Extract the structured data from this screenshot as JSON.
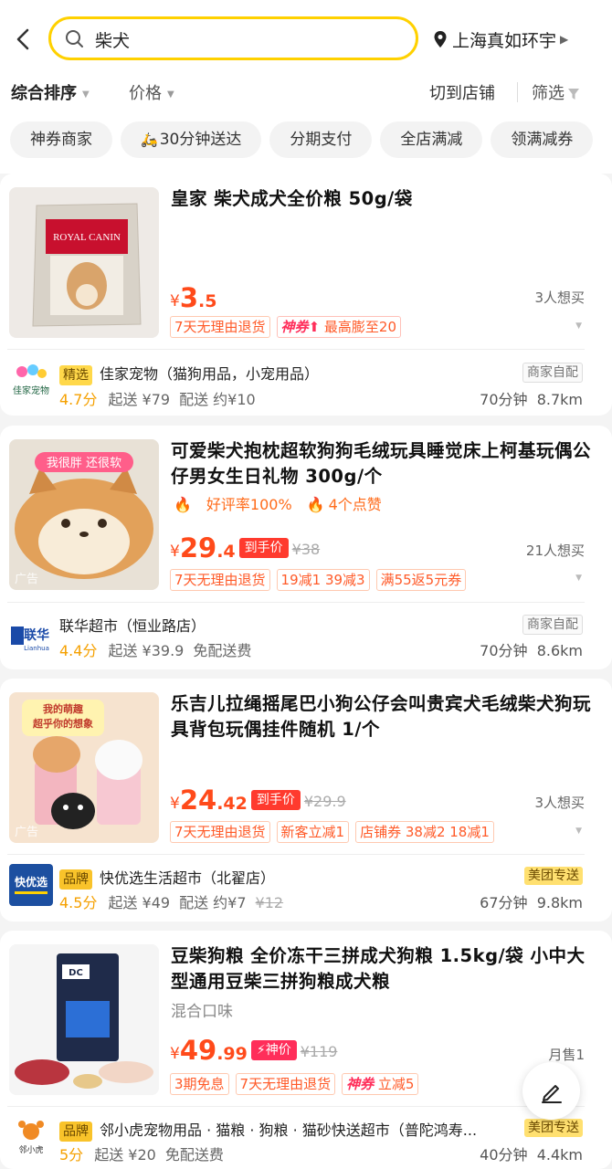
{
  "header": {
    "search_query": "柴犬",
    "location": "上海真如环宇"
  },
  "sort_bar": {
    "comprehensive": "综合排序",
    "price": "价格",
    "switch_to_store": "切到店铺",
    "filter": "筛选"
  },
  "filter_chips": [
    "神券商家",
    "30分钟送达",
    "分期支付",
    "全店满减",
    "领满减券"
  ],
  "products": [
    {
      "title": "皇家 柴犬成犬全价粮 50g/袋",
      "price_int": "3",
      "price_dec": ".5",
      "want": "3人想买",
      "tags": [
        "7天无理由退货"
      ],
      "promo_label": "神券",
      "promo_text": "最高膨至20",
      "shop": {
        "badge": "精选",
        "name": "佳家宠物（猫狗用品，小宠用品）",
        "rating": "4.7分",
        "min_order": "起送 ¥79",
        "delivery": "配送 约¥10",
        "time": "70分钟",
        "distance": "8.7km",
        "ship_tag": "商家自配",
        "logo_text": "佳家宠物"
      },
      "image_text": "ROYAL CANIN"
    },
    {
      "title": "可爱柴犬抱枕超软狗狗毛绒玩具睡觉床上柯基玩偶公仔男女生日礼物 300g/个",
      "hot": [
        "好评率100%",
        "4个点赞"
      ],
      "price_int": "29",
      "price_dec": ".4",
      "final_label": "到手价",
      "old_price": "¥38",
      "want": "21人想买",
      "tags": [
        "7天无理由退货",
        "19减1 39减3",
        "满55返5元券"
      ],
      "ad_label": "广告",
      "image_banner": "我很胖 还很软",
      "shop": {
        "name": "联华超市（恒业路店）",
        "rating": "4.4分",
        "min_order": "起送 ¥39.9",
        "delivery": "免配送费",
        "time": "70分钟",
        "distance": "8.6km",
        "ship_tag": "商家自配",
        "logo_text": "联华",
        "logo_sub": "Lianhua"
      }
    },
    {
      "title": "乐吉儿拉绳摇尾巴小狗公仔会叫贵宾犬毛绒柴犬狗玩具背包玩偶挂件随机 1/个",
      "price_int": "24",
      "price_dec": ".42",
      "final_label": "到手价",
      "old_price": "¥29.9",
      "want": "3人想买",
      "tags": [
        "7天无理由退货",
        "新客立减1",
        "店铺券 38减2 18减1"
      ],
      "ad_label": "广告",
      "image_banner": "我的萌趣 超乎你的想象",
      "shop": {
        "badge": "品牌",
        "name": "快优选生活超市（北翟店）",
        "rating": "4.5分",
        "min_order": "起送 ¥49",
        "delivery": "配送 约¥7",
        "delivery_old": "¥12",
        "time": "67分钟",
        "distance": "9.8km",
        "ship_tag": "美团专送",
        "logo_text": "快优选"
      }
    },
    {
      "title": "豆柴狗粮 全价冻干三拼成犬狗粮 1.5kg/袋 小中大型通用豆柴三拼狗粮成犬粮",
      "flavor": "混合口味",
      "price_int": "49",
      "price_dec": ".99",
      "final_label": "神价",
      "old_price": "¥119",
      "want": "月售1",
      "tags": [
        "3期免息",
        "7天无理由退货"
      ],
      "promo_label": "神券",
      "promo_text": "立减5",
      "shop": {
        "badge": "品牌",
        "name": "邻小虎宠物用品 · 猫粮 · 狗粮 · 猫砂快送超市（普陀鸿寿...",
        "rating": "5分",
        "min_order": "起送 ¥20",
        "delivery": "免配送费",
        "time": "40分钟",
        "distance": "4.4km",
        "ship_tag": "美团专送",
        "logo_text": "邻小虎"
      }
    }
  ],
  "colors": {
    "accent_yellow": "#ffd100",
    "price_red": "#ff4a1a"
  }
}
